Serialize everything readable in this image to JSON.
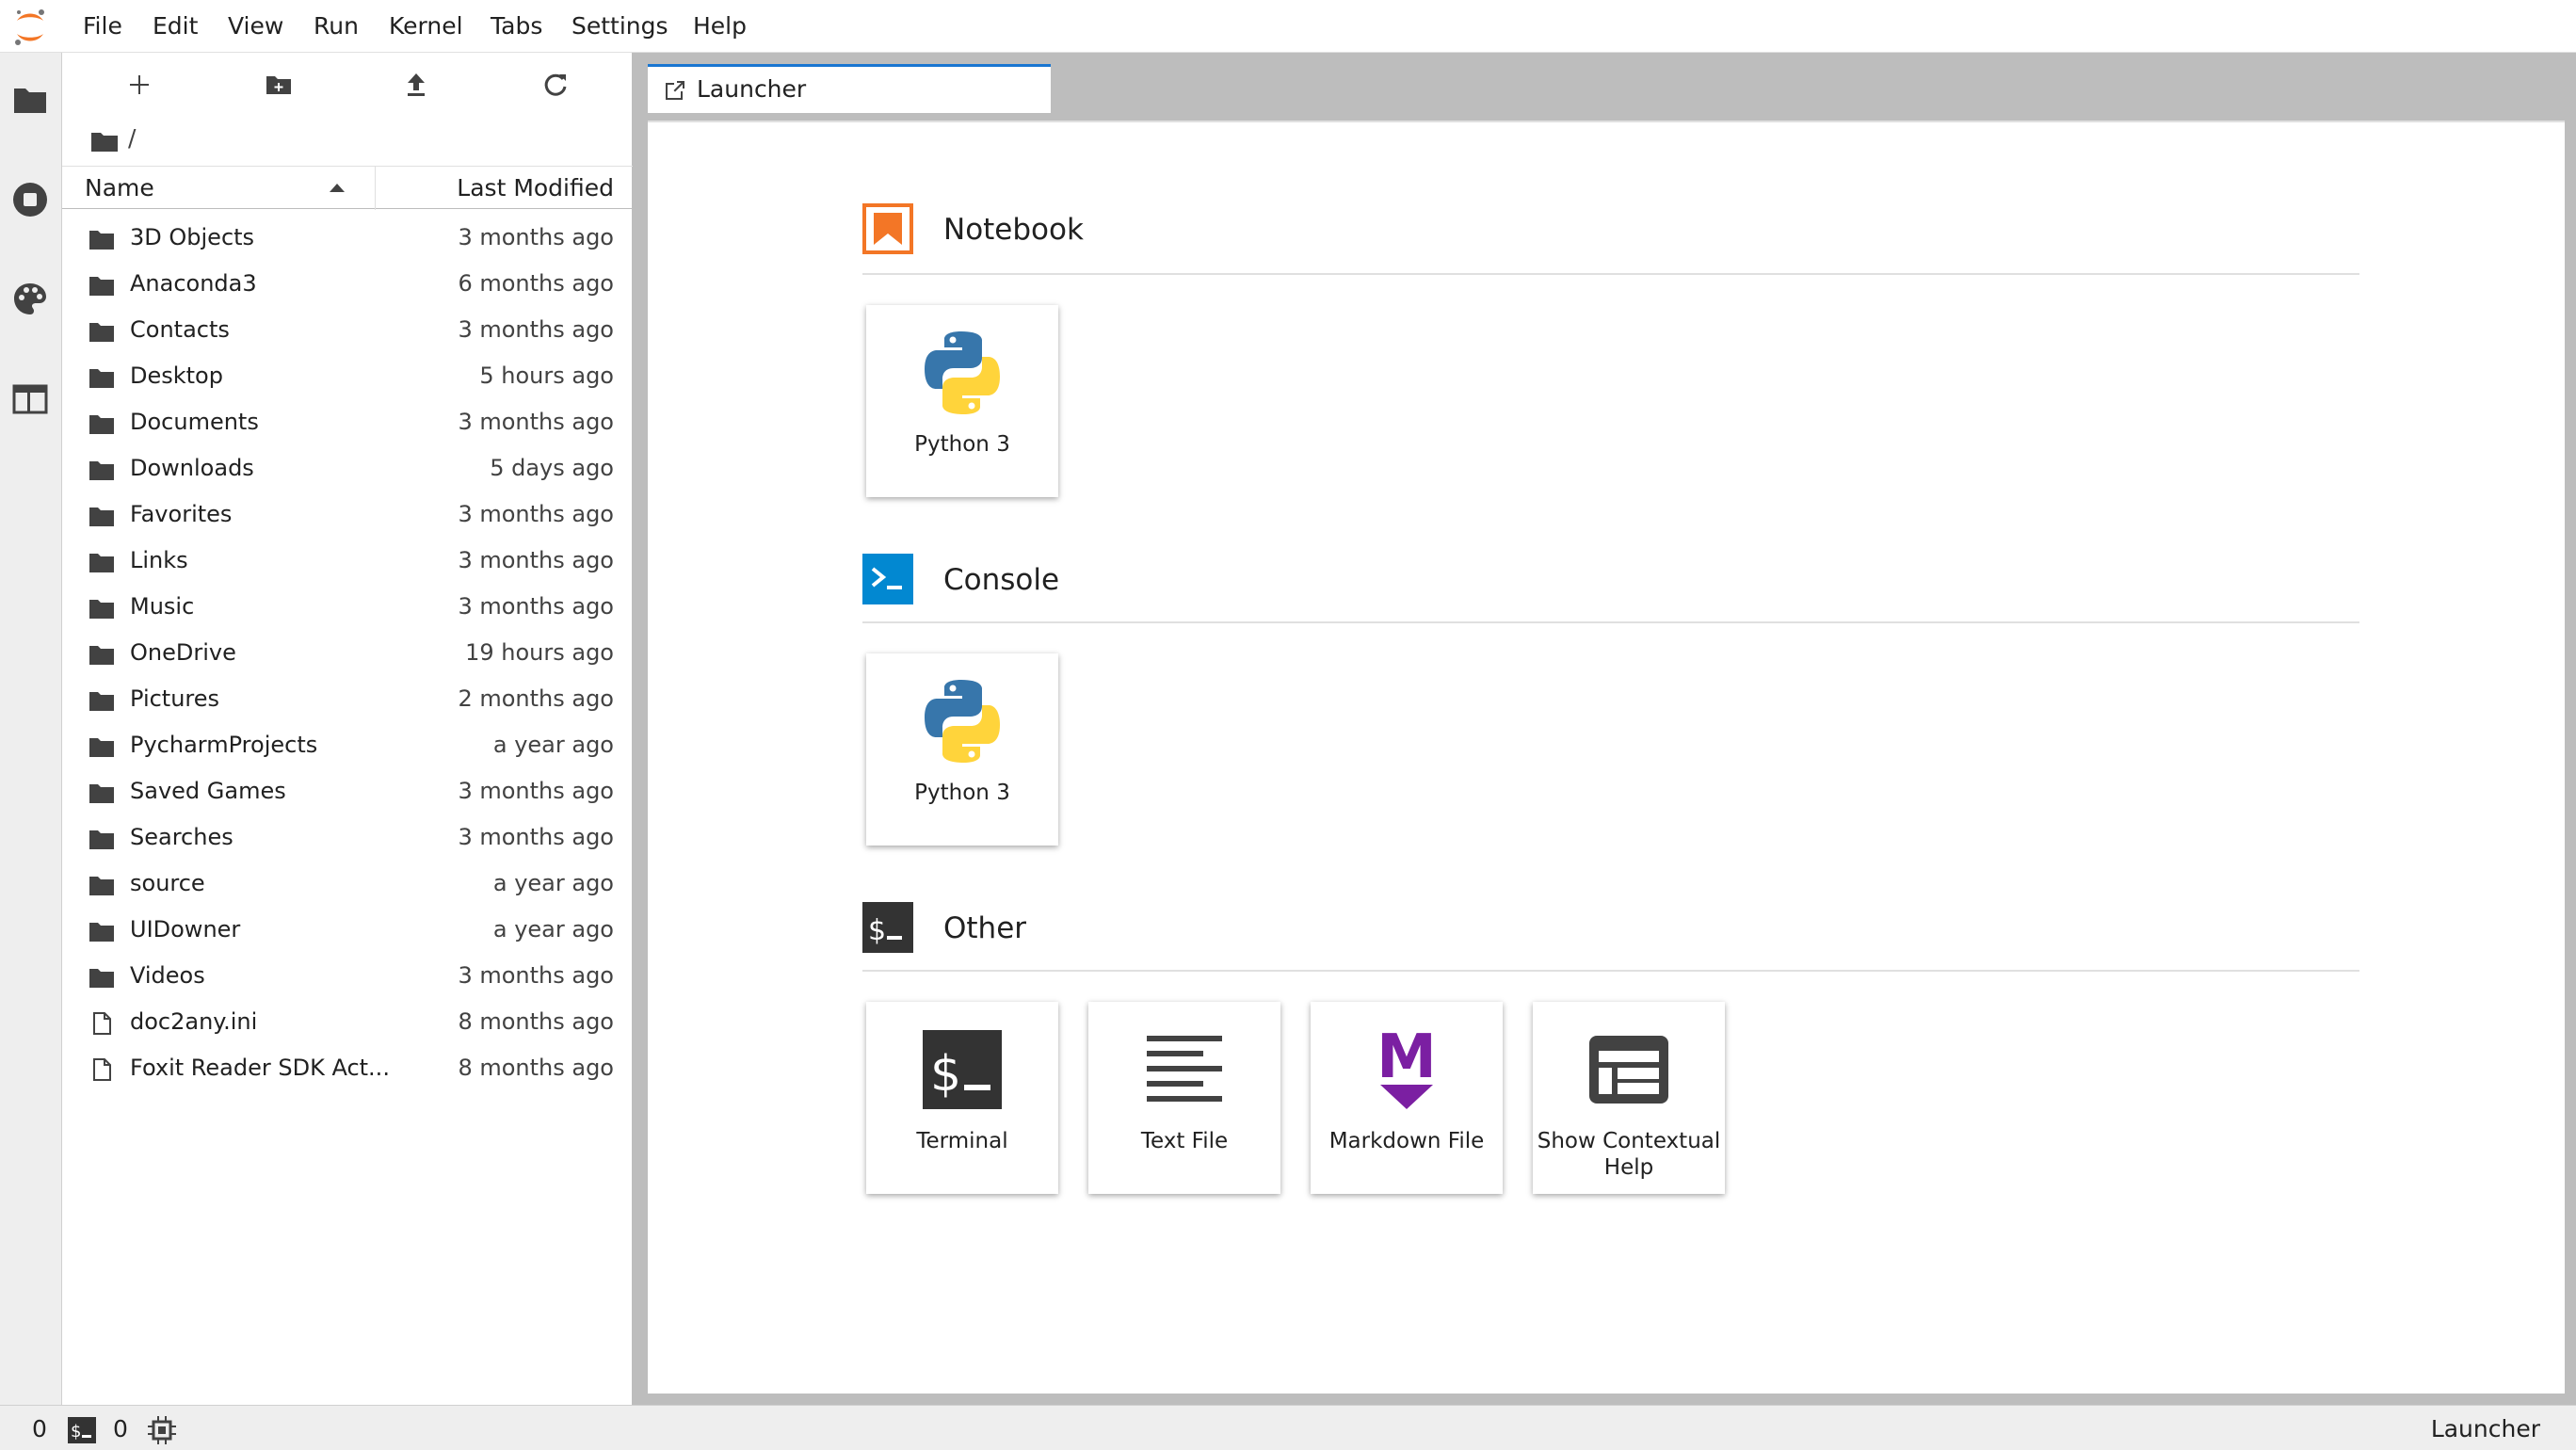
{
  "menubar": {
    "items": [
      "File",
      "Edit",
      "View",
      "Run",
      "Kernel",
      "Tabs",
      "Settings",
      "Help"
    ]
  },
  "activitybar": {
    "icons": [
      "folder-icon",
      "running-icon",
      "palette-icon",
      "tabs-icon"
    ]
  },
  "filebrowser": {
    "toolbar": [
      "new-launcher-icon",
      "new-folder-icon",
      "upload-icon",
      "refresh-icon"
    ],
    "breadcrumb": "/",
    "columns": {
      "name": "Name",
      "modified": "Last Modified"
    },
    "items": [
      {
        "name": "3D Objects",
        "modified": "3 months ago",
        "type": "folder"
      },
      {
        "name": "Anaconda3",
        "modified": "6 months ago",
        "type": "folder"
      },
      {
        "name": "Contacts",
        "modified": "3 months ago",
        "type": "folder"
      },
      {
        "name": "Desktop",
        "modified": "5 hours ago",
        "type": "folder"
      },
      {
        "name": "Documents",
        "modified": "3 months ago",
        "type": "folder"
      },
      {
        "name": "Downloads",
        "modified": "5 days ago",
        "type": "folder"
      },
      {
        "name": "Favorites",
        "modified": "3 months ago",
        "type": "folder"
      },
      {
        "name": "Links",
        "modified": "3 months ago",
        "type": "folder"
      },
      {
        "name": "Music",
        "modified": "3 months ago",
        "type": "folder"
      },
      {
        "name": "OneDrive",
        "modified": "19 hours ago",
        "type": "folder"
      },
      {
        "name": "Pictures",
        "modified": "2 months ago",
        "type": "folder"
      },
      {
        "name": "PycharmProjects",
        "modified": "a year ago",
        "type": "folder"
      },
      {
        "name": "Saved Games",
        "modified": "3 months ago",
        "type": "folder"
      },
      {
        "name": "Searches",
        "modified": "3 months ago",
        "type": "folder"
      },
      {
        "name": "source",
        "modified": "a year ago",
        "type": "folder"
      },
      {
        "name": "UIDowner",
        "modified": "a year ago",
        "type": "folder"
      },
      {
        "name": "Videos",
        "modified": "3 months ago",
        "type": "folder"
      },
      {
        "name": "doc2any.ini",
        "modified": "8 months ago",
        "type": "file"
      },
      {
        "name": "Foxit Reader SDK Act...",
        "modified": "8 months ago",
        "type": "file"
      }
    ]
  },
  "tabs": [
    {
      "label": "Launcher",
      "active": true
    }
  ],
  "launcher": {
    "sections": [
      {
        "title": "Notebook",
        "cards": [
          {
            "label": "Python 3",
            "icon": "python-icon"
          }
        ]
      },
      {
        "title": "Console",
        "cards": [
          {
            "label": "Python 3",
            "icon": "python-icon"
          }
        ]
      },
      {
        "title": "Other",
        "cards": [
          {
            "label": "Terminal",
            "icon": "terminal-icon"
          },
          {
            "label": "Text File",
            "icon": "text-file-icon"
          },
          {
            "label": "Markdown File",
            "icon": "markdown-icon"
          },
          {
            "label": "Show Contextual Help",
            "icon": "contextual-help-icon"
          }
        ]
      }
    ]
  },
  "statusbar": {
    "kernels_count": "0",
    "terminals_count": "0",
    "right_label": "Launcher"
  },
  "colors": {
    "accent": "#1976d2",
    "notebook_orange": "#f37626",
    "console_blue": "#0288d1",
    "dark_gray": "#333333",
    "markdown_purple": "#7b1fa2"
  }
}
